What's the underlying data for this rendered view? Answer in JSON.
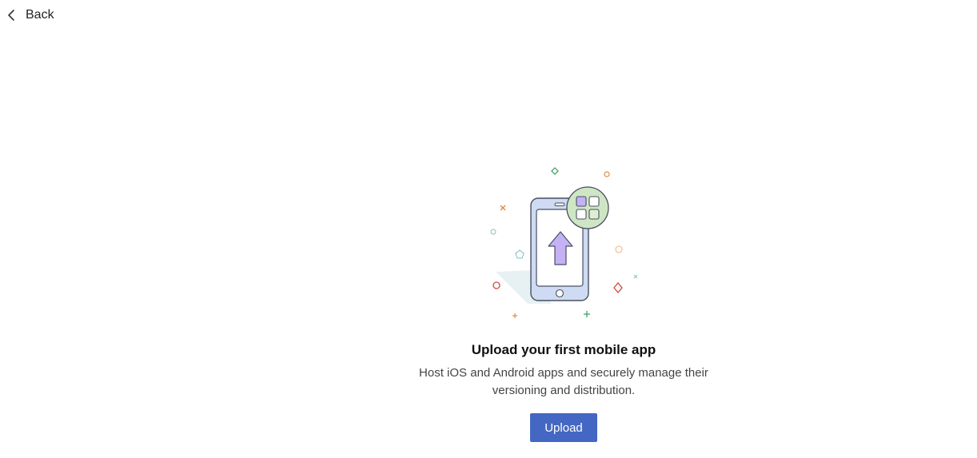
{
  "header": {
    "back_label": "Back",
    "back_icon": "chevron-left-icon"
  },
  "empty_state": {
    "illustration_icon": "phone-upload-illustration",
    "title": "Upload your first mobile app",
    "description_line1": "Host iOS and Android apps and securely manage their",
    "description_line2": "versioning and distribution.",
    "upload_label": "Upload"
  },
  "colors": {
    "button": "#4467c4",
    "phone_fill": "#cfdbf2",
    "arrow": "#c4b2f4",
    "apps_circle": "#cfe6c4"
  }
}
